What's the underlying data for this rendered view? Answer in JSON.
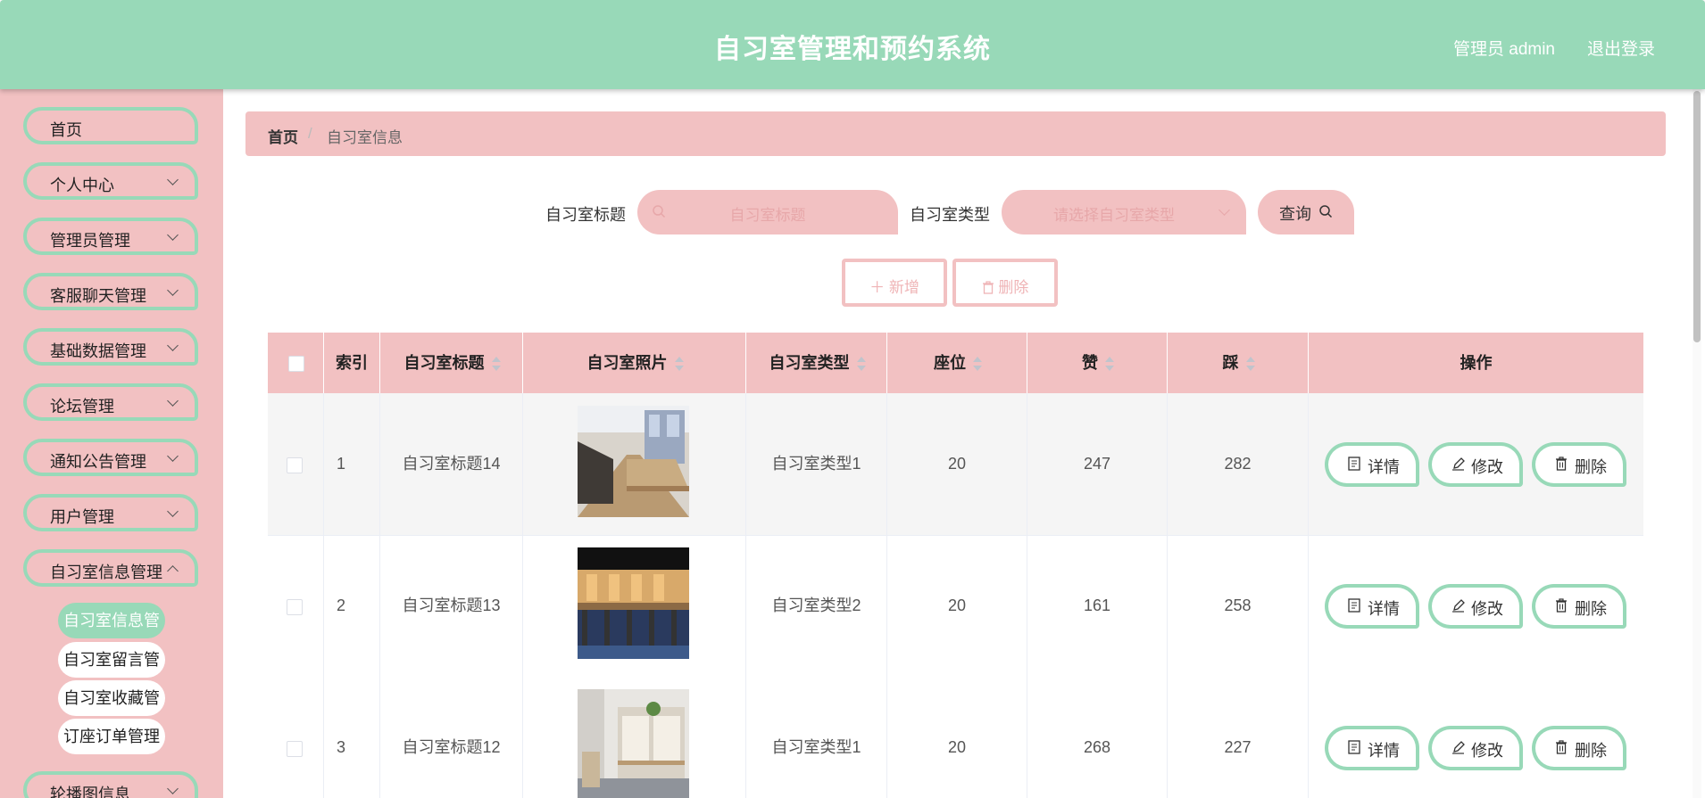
{
  "header": {
    "title": "自习室管理和预约系统",
    "user": "管理员 admin",
    "logout": "退出登录"
  },
  "sidebar": {
    "items": [
      {
        "label": "首页"
      },
      {
        "label": "个人中心"
      },
      {
        "label": "管理员管理"
      },
      {
        "label": "客服聊天管理"
      },
      {
        "label": "基础数据管理"
      },
      {
        "label": "论坛管理"
      },
      {
        "label": "通知公告管理"
      },
      {
        "label": "用户管理"
      },
      {
        "label": "自习室信息管理"
      },
      {
        "label": "轮播图信息"
      }
    ],
    "sub_items": [
      {
        "label": "自习室信息管理"
      },
      {
        "label": "自习室留言管理"
      },
      {
        "label": "自习室收藏管理"
      },
      {
        "label": "订座订单管理"
      }
    ]
  },
  "breadcrumb": {
    "home": "首页",
    "sep": "/",
    "current": "自习室信息"
  },
  "search": {
    "title_label": "自习室标题",
    "title_placeholder": "自习室标题",
    "type_label": "自习室类型",
    "type_placeholder": "请选择自习室类型",
    "query": "查询"
  },
  "actions": {
    "add": "新增",
    "delete": "删除"
  },
  "table": {
    "headers": [
      "索引",
      "自习室标题",
      "自习室照片",
      "自习室类型",
      "座位",
      "赞",
      "踩",
      "操作"
    ],
    "rows": [
      {
        "index": "1",
        "title": "自习室标题14",
        "type": "自习室类型1",
        "seats": "20",
        "likes": "247",
        "dislikes": "282"
      },
      {
        "index": "2",
        "title": "自习室标题13",
        "type": "自习室类型2",
        "seats": "20",
        "likes": "161",
        "dislikes": "258"
      },
      {
        "index": "3",
        "title": "自习室标题12",
        "type": "自习室类型1",
        "seats": "20",
        "likes": "268",
        "dislikes": "227"
      }
    ],
    "ops": {
      "detail": "详情",
      "edit": "修改",
      "delete": "删除"
    }
  },
  "colors": {
    "header": "#98d9b8",
    "pink": "#f2c1c2",
    "green": "#98d9b8"
  }
}
